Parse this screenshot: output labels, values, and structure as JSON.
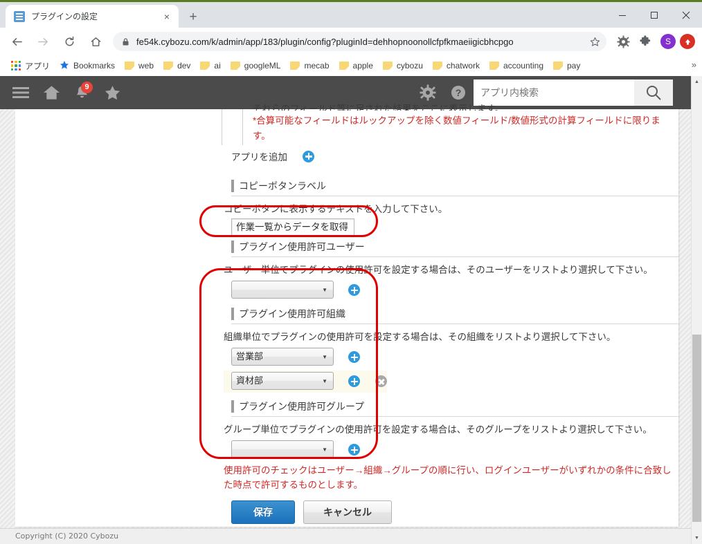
{
  "browser": {
    "tab": {
      "title": "プラグインの設定",
      "favicon": "kintone-app-icon",
      "close": "×"
    },
    "new_tab_label": "+",
    "window_controls": {
      "minimize": "minimize-icon",
      "maximize": "maximize-icon",
      "close": "close-icon"
    },
    "nav": {
      "back": "back-arrow-icon",
      "forward": "forward-arrow-icon",
      "reload": "reload-icon",
      "home": "home-icon"
    },
    "omnibox": {
      "lock": "lock-icon",
      "url": "fe54k.cybozu.com/k/admin/app/183/plugin/config?pluginId=dehhopnoonollcfpfkmaeiigicbhcpgo",
      "bookmark_star": "star-outline-icon"
    },
    "toolbar_extras": {
      "gear_extension": "gear-icon",
      "extensions": "puzzle-piece-icon",
      "profile_initial": "S",
      "update": "update-arrow-icon"
    },
    "bookmarks": [
      {
        "label": "アプリ",
        "icon": "apps-grid-icon"
      },
      {
        "label": "Bookmarks",
        "icon": "star-icon"
      },
      {
        "label": "web",
        "icon": "folder-icon"
      },
      {
        "label": "dev",
        "icon": "folder-icon"
      },
      {
        "label": "ai",
        "icon": "folder-icon"
      },
      {
        "label": "googleML",
        "icon": "folder-icon"
      },
      {
        "label": "mecab",
        "icon": "folder-icon"
      },
      {
        "label": "apple",
        "icon": "folder-icon"
      },
      {
        "label": "cybozu",
        "icon": "folder-icon"
      },
      {
        "label": "chatwork",
        "icon": "folder-icon"
      },
      {
        "label": "accounting",
        "icon": "folder-icon"
      },
      {
        "label": "pay",
        "icon": "folder-icon"
      }
    ],
    "bookmarks_overflow": "»"
  },
  "kintone_header": {
    "menu_icon": "hamburger-menu-icon",
    "home_icon": "home-icon",
    "bell_icon": "bell-icon",
    "notification_count": "9",
    "favorite_icon": "star-icon",
    "settings_icon": "gear-icon",
    "help_icon": "question-mark-icon",
    "search_placeholder": "アプリ内検索",
    "search_value": "",
    "search_button_icon": "magnifier-icon"
  },
  "form": {
    "truncated_note": "それらのフィールド等に足された結果をここに表示します。",
    "red_note": "*合算可能なフィールドはルックアップを除く数値フィールド/数値形式の計算フィールドに限ります。",
    "add_app_label": "アプリを追加",
    "add_app_plus": "plus-icon",
    "sections": [
      {
        "heading": "コピーボタンラベル",
        "description": "コピーボタンに表示するテキストを入力して下さい。",
        "input_value": "作業一覧からデータを取得"
      },
      {
        "heading": "プラグイン使用許可ユーザー",
        "description": "ユーザー単位でプラグインの使用許可を設定する場合は、そのユーザーをリストより選択して下さい。",
        "rows": [
          {
            "selected": "",
            "plus": "plus-icon",
            "minus": null
          }
        ]
      },
      {
        "heading": "プラグイン使用許可組織",
        "description": "組織単位でプラグインの使用許可を設定する場合は、その組織をリストより選択して下さい。",
        "rows": [
          {
            "selected": "営業部",
            "plus": "plus-icon",
            "minus": null
          },
          {
            "selected": "資材部",
            "plus": "plus-icon",
            "minus": "minus-icon"
          }
        ]
      },
      {
        "heading": "プラグイン使用許可グループ",
        "description": "グループ単位でプラグインの使用許可を設定する場合は、そのグループをリストより選択して下さい。",
        "rows": [
          {
            "selected": "",
            "plus": "plus-icon",
            "minus": null
          }
        ]
      }
    ],
    "warning": "使用許可のチェックはユーザー→組織→グループの順に行い、ログインユーザーがいずれかの条件に合致した時点で許可するものとします。",
    "buttons": {
      "save": "保存",
      "cancel": "キャンセル"
    }
  },
  "footer": {
    "copyright": "Copyright (C) 2020 Cybozu"
  },
  "scrollbar": {
    "up_arrow": "▲",
    "down_arrow": "▼"
  },
  "colors": {
    "accent_blue": "#2e9be0",
    "save_blue": "#1b72bb",
    "warning_red": "#cf2a27",
    "annotation_red": "#e00000",
    "header_dark": "#4b4b4b",
    "badge_red": "#e8443a"
  }
}
